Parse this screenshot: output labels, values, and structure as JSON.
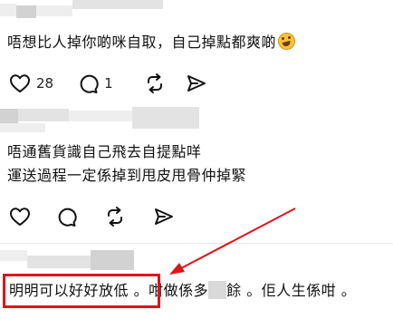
{
  "comments": [
    {
      "text": "唔想比人掉你啲咪自取，自己掉點都爽啲",
      "emoji": "rofl-emoji",
      "likes": "28",
      "replies": "1"
    },
    {
      "line1": "唔通舊貨識自己飛去自提點咩",
      "line2": "運送過程一定係掉到甩皮甩骨仲掉緊"
    },
    {
      "highlighted": "明明可以好好放低",
      "rest_a": " 。咁做係多",
      "rest_b": "餘 。佢人生係咁 。"
    }
  ],
  "colors": {
    "annotation_red": "#e3121b"
  },
  "icons": [
    "heart-icon",
    "reply-icon",
    "repost-icon",
    "share-icon"
  ]
}
